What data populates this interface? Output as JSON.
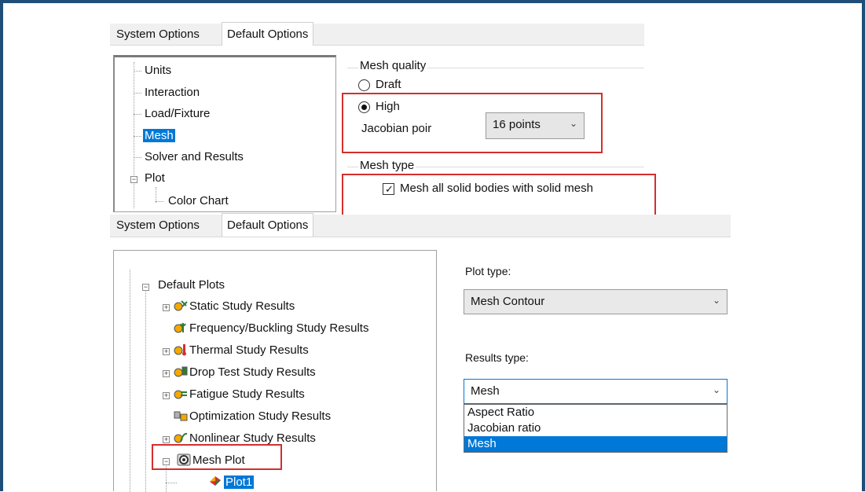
{
  "top_panel": {
    "tabs": [
      "System Options",
      "Default Options"
    ],
    "tree": [
      "Units",
      "Interaction",
      "Load/Fixture",
      "Mesh",
      "Solver and Results",
      "Plot",
      "Color Chart"
    ],
    "mesh_quality": {
      "group_label": "Mesh quality",
      "draft_label": "Draft",
      "high_label": "High",
      "jacobian_label": "Jacobian poir",
      "jacobian_value": "16 points"
    },
    "mesh_type": {
      "group_label": "Mesh type",
      "checkbox_label": "Mesh all solid bodies with solid mesh"
    }
  },
  "bottom_panel": {
    "tabs": [
      "System Options",
      "Default Options"
    ],
    "tree": {
      "root": "Default Plots",
      "items": [
        "Static Study Results",
        "Frequency/Buckling Study Results",
        "Thermal Study Results",
        "Drop Test Study Results",
        "Fatigue Study Results",
        "Optimization Study Results",
        "Nonlinear Study Results",
        "Mesh Plot",
        "Plot1"
      ]
    },
    "plot_type": {
      "label": "Plot type:",
      "value": "Mesh Contour"
    },
    "results_type": {
      "label": "Results type:",
      "value": "Mesh",
      "options": [
        "Aspect Ratio",
        "Jacobian ratio",
        "Mesh"
      ]
    }
  },
  "colors": {
    "selection": "#0078d7",
    "highlight_box": "#d32f2f",
    "frame": "#1f4e79"
  }
}
